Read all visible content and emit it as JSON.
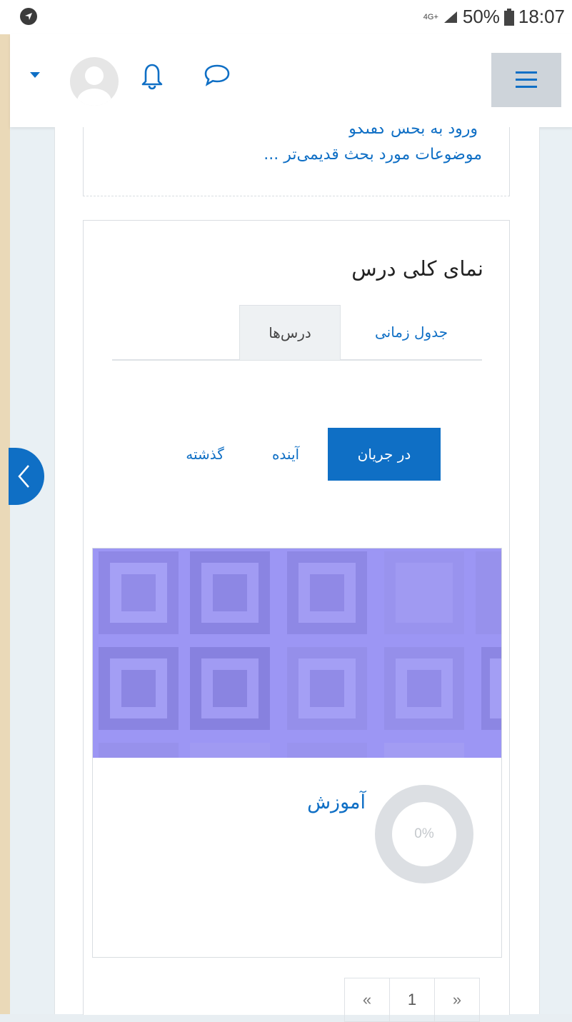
{
  "status_bar": {
    "network": "4G+",
    "battery": "50%",
    "time": "18:07"
  },
  "navbar": {
    "menu_icon": "hamburger-icon",
    "notification_icon": "bell-icon",
    "messages_icon": "chat-bubble-icon",
    "user_icon": "avatar",
    "dropdown_icon": "caret-down-icon"
  },
  "forum_block": {
    "partial_text": "ورود به بخش گفتگو",
    "older_topics_link": "موضوعات مورد بحث قدیمی‌تر ..."
  },
  "course_overview": {
    "title": "نمای کلی درس",
    "tabs": [
      {
        "label": "جدول زمانی",
        "active": false
      },
      {
        "label": "درس‌ها",
        "active": true
      }
    ],
    "filters": [
      {
        "label": "در جریان",
        "active": true
      },
      {
        "label": "آینده",
        "active": false
      },
      {
        "label": "گذشته",
        "active": false
      }
    ],
    "course": {
      "name": "آموزش",
      "progress_label": "0%",
      "progress": 0
    },
    "pagination": {
      "prev": "«",
      "page": "1",
      "next": "»"
    }
  },
  "colors": {
    "accent": "#0f6fc5",
    "course_image": "#9c96f4"
  }
}
